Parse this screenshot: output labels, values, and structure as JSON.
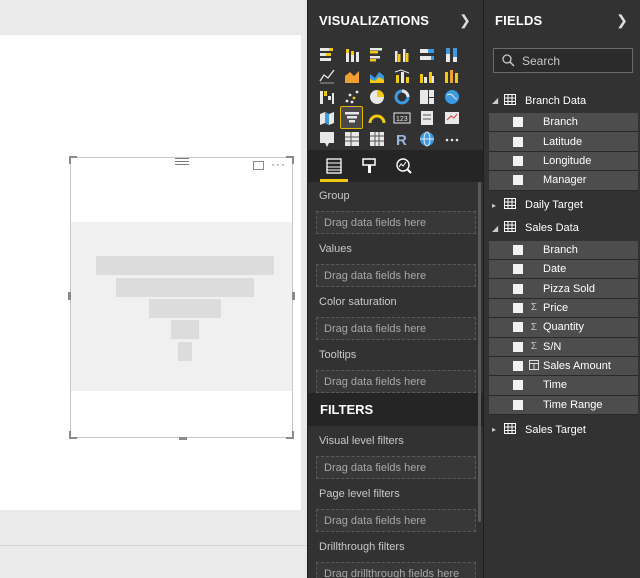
{
  "visualizations": {
    "title": "VISUALIZATIONS",
    "icons": [
      "stacked-bar-chart-icon",
      "stacked-column-chart-icon",
      "clustered-bar-chart-icon",
      "clustered-column-chart-icon",
      "100-stacked-bar-chart-icon",
      "100-stacked-column-chart-icon",
      "line-chart-icon",
      "area-chart-icon",
      "stacked-area-chart-icon",
      "line-and-stacked-column-chart-icon",
      "line-and-clustered-column-chart-icon",
      "ribbon-chart-icon",
      "waterfall-chart-icon",
      "scatter-chart-icon",
      "pie-chart-icon",
      "donut-chart-icon",
      "treemap-icon",
      "map-icon",
      "filled-map-icon",
      "funnel-icon",
      "gauge-icon",
      "card-icon",
      "multi-row-card-icon",
      "kpi-icon",
      "slicer-icon",
      "table-icon",
      "matrix-icon",
      "r-script-visual-icon",
      "globe-icon",
      "more-visuals-icon"
    ],
    "selected_icon": "funnel-icon",
    "tabs": [
      "fields-tab-icon",
      "format-tab-icon",
      "analytics-tab-icon"
    ],
    "wells": [
      {
        "label": "Group",
        "drop": "Drag data fields here"
      },
      {
        "label": "Values",
        "drop": "Drag data fields here"
      },
      {
        "label": "Color saturation",
        "drop": "Drag data fields here"
      },
      {
        "label": "Tooltips",
        "drop": "Drag data fields here"
      }
    ]
  },
  "filters": {
    "title": "FILTERS",
    "blocks": [
      {
        "label": "Visual level filters",
        "drop": "Drag data fields here"
      },
      {
        "label": "Page level filters",
        "drop": "Drag data fields here"
      },
      {
        "label": "Drillthrough filters",
        "drop": "Drag drillthrough fields here"
      }
    ]
  },
  "fields": {
    "title": "FIELDS",
    "search_placeholder": "Search",
    "tables": [
      {
        "name": "Branch Data",
        "expanded": true,
        "fields": [
          {
            "name": "Branch",
            "icon": ""
          },
          {
            "name": "Latitude",
            "icon": ""
          },
          {
            "name": "Longitude",
            "icon": ""
          },
          {
            "name": "Manager",
            "icon": ""
          }
        ]
      },
      {
        "name": "Daily Target",
        "expanded": false,
        "fields": []
      },
      {
        "name": "Sales Data",
        "expanded": true,
        "fields": [
          {
            "name": "Branch",
            "icon": ""
          },
          {
            "name": "Date",
            "icon": ""
          },
          {
            "name": "Pizza Sold",
            "icon": ""
          },
          {
            "name": "Price",
            "icon": "sigma"
          },
          {
            "name": "Quantity",
            "icon": "sigma"
          },
          {
            "name": "S/N",
            "icon": "sigma"
          },
          {
            "name": "Sales Amount",
            "icon": "calculator"
          },
          {
            "name": "Time",
            "icon": ""
          },
          {
            "name": "Time Range",
            "icon": ""
          }
        ]
      },
      {
        "name": "Sales Target",
        "expanded": false,
        "fields": []
      }
    ]
  },
  "colors": {
    "pane_bg": "#323232",
    "accent": "#f2c811",
    "field_row_bg": "#4d4d4d",
    "funnel_placeholder": "#dcdcdc"
  }
}
